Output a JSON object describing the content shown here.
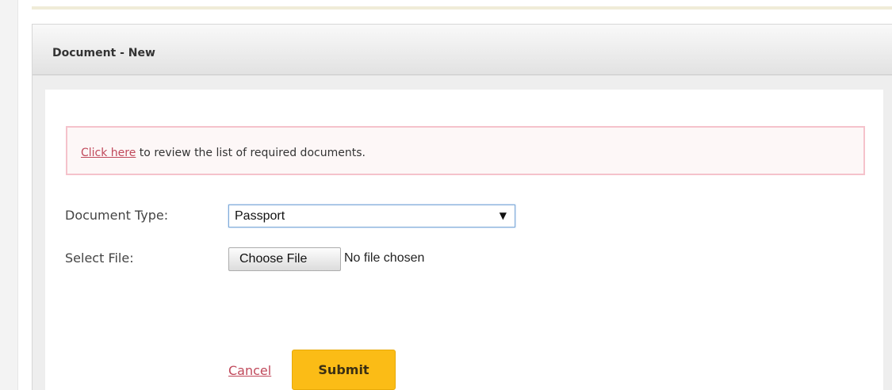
{
  "panel": {
    "title": "Document - New"
  },
  "notice": {
    "link_text": "Click here",
    "text": " to review the list of required documents."
  },
  "form": {
    "document_type": {
      "label": "Document Type:",
      "selected_value": "Passport",
      "arrow": "▼"
    },
    "file": {
      "label": "Select File:",
      "button_label": "Choose File",
      "status": "No file chosen"
    }
  },
  "actions": {
    "cancel_label": "Cancel",
    "submit_label": "Submit"
  },
  "colors": {
    "accent": "#fbbc16",
    "link": "#c0495b",
    "notice_border": "#f5c2cb",
    "panel_header": "#e2e2e2"
  },
  "icons": {
    "select_arrow": "chevron-down-icon"
  }
}
